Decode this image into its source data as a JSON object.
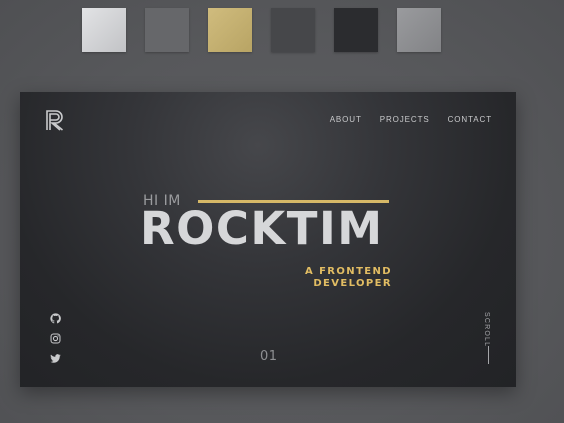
{
  "palette": {
    "swatches": [
      {
        "name": "light-gray",
        "color": "#d7d8da"
      },
      {
        "name": "mid-gray",
        "color": "#66676a"
      },
      {
        "name": "gold",
        "color": "#c7b273"
      },
      {
        "name": "dark-gray",
        "color": "#46474a"
      },
      {
        "name": "charcoal",
        "color": "#2b2c2f"
      },
      {
        "name": "silver",
        "color": "#8f9093"
      }
    ]
  },
  "hero": {
    "logo_icon": "r-monogram-icon",
    "nav": {
      "about": "ABOUT",
      "projects": "PROJECTS",
      "contact": "CONTACT"
    },
    "greeting": "HI IM",
    "name": "ROCKTIM",
    "role_line1": "A FRONTEND",
    "role_line2": "DEVELOPER",
    "accent_color": "#d6b867",
    "socials": [
      "github-icon",
      "instagram-icon",
      "twitter-icon"
    ],
    "page_number": "01",
    "scroll_label": "SCROLL"
  }
}
